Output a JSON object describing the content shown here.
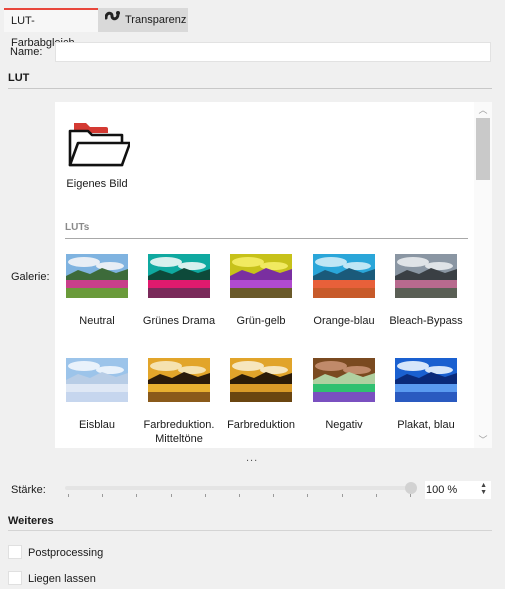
{
  "tabs": [
    {
      "label": "LUT-Farbabgleich",
      "active": true
    },
    {
      "label": "Transparenz",
      "active": false,
      "icon": "transparency-icon"
    }
  ],
  "name": {
    "label": "Name:",
    "value": ""
  },
  "lut_section": {
    "title": "LUT"
  },
  "gallery": {
    "label": "Galerie:",
    "own_image_label": "Eigenes Bild",
    "luts_header": "LUTs",
    "items": [
      {
        "label": "Neutral",
        "style": "neutral"
      },
      {
        "label": "Grünes Drama",
        "style": "green-drama"
      },
      {
        "label": "Grün-gelb",
        "style": "green-yellow"
      },
      {
        "label": "Orange-blau",
        "style": "orange-blue"
      },
      {
        "label": "Bleach-Bypass",
        "style": "bleach"
      },
      {
        "label": "Eisblau",
        "style": "ice-blue"
      },
      {
        "label": "Farbreduktion. Mitteltöne",
        "style": "reduction-mid"
      },
      {
        "label": "Farbreduktion",
        "style": "reduction"
      },
      {
        "label": "Negativ",
        "style": "negative"
      },
      {
        "label": "Plakat, blau",
        "style": "poster-blue"
      }
    ],
    "more": "..."
  },
  "strength": {
    "label": "Stärke:",
    "value": 100,
    "display": "100 %"
  },
  "more_section": {
    "title": "Weiteres",
    "options": [
      {
        "label": "Postprocessing",
        "checked": false
      },
      {
        "label": "Liegen lassen",
        "checked": false
      }
    ]
  },
  "colors": {
    "accent": "#e8463b"
  }
}
